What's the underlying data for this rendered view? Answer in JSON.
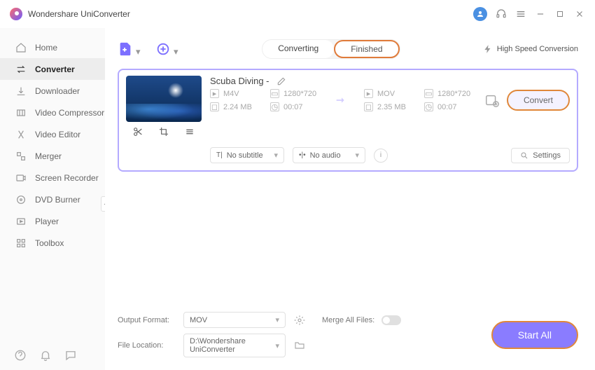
{
  "app": {
    "title": "Wondershare UniConverter"
  },
  "sidebar": {
    "items": [
      {
        "label": "Home",
        "icon": "home"
      },
      {
        "label": "Converter",
        "icon": "converter"
      },
      {
        "label": "Downloader",
        "icon": "downloader"
      },
      {
        "label": "Video Compressor",
        "icon": "compressor"
      },
      {
        "label": "Video Editor",
        "icon": "editor"
      },
      {
        "label": "Merger",
        "icon": "merger"
      },
      {
        "label": "Screen Recorder",
        "icon": "recorder"
      },
      {
        "label": "DVD Burner",
        "icon": "burner"
      },
      {
        "label": "Player",
        "icon": "player"
      },
      {
        "label": "Toolbox",
        "icon": "toolbox"
      }
    ],
    "active_index": 1
  },
  "topbar": {
    "tabs": {
      "converting": "Converting",
      "finished": "Finished"
    },
    "speed_label": "High Speed Conversion"
  },
  "file": {
    "title": "Scuba Diving -",
    "source": {
      "format": "M4V",
      "resolution": "1280*720",
      "size": "2.24 MB",
      "duration": "00:07"
    },
    "target": {
      "format": "MOV",
      "resolution": "1280*720",
      "size": "2.35 MB",
      "duration": "00:07"
    },
    "subtitle_dd": "No subtitle",
    "audio_dd": "No audio",
    "settings_label": "Settings",
    "convert_label": "Convert"
  },
  "footer": {
    "output_format_label": "Output Format:",
    "output_format_value": "MOV",
    "file_location_label": "File Location:",
    "file_location_value": "D:\\Wondershare UniConverter",
    "merge_label": "Merge All Files:",
    "start_all_label": "Start All"
  }
}
